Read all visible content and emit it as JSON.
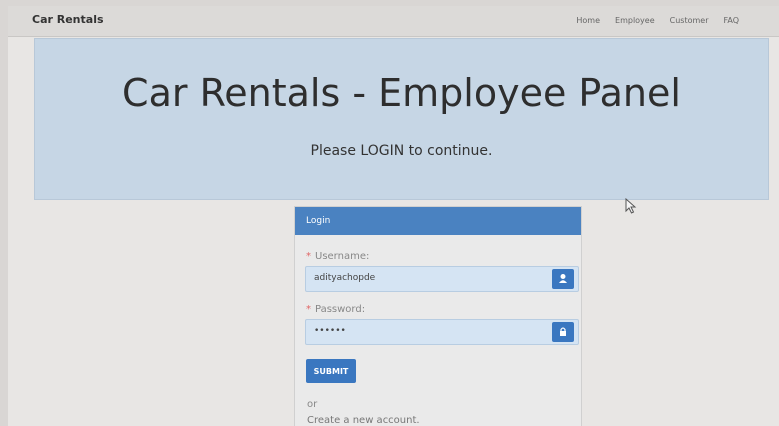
{
  "navbar": {
    "brand": "Car Rentals",
    "links": [
      "Home",
      "Employee",
      "Customer",
      "FAQ"
    ]
  },
  "jumbotron": {
    "title": "Car Rentals - Employee Panel",
    "subtitle": "Please LOGIN to continue."
  },
  "login": {
    "heading": "Login",
    "username_label": "Username:",
    "username_value": "adityachopde",
    "password_label": "Password:",
    "password_value": "••••••",
    "required_mark": "*",
    "submit_label": "SUBMIT",
    "or_text": "or",
    "create_account": "Create a new account."
  },
  "colors": {
    "primary": "#3a77c0",
    "jumbotron_bg": "#c6d6e5"
  },
  "icons": {
    "username_addon": "user-icon",
    "password_addon": "lock-icon",
    "pointer": "mouse-pointer-icon"
  }
}
